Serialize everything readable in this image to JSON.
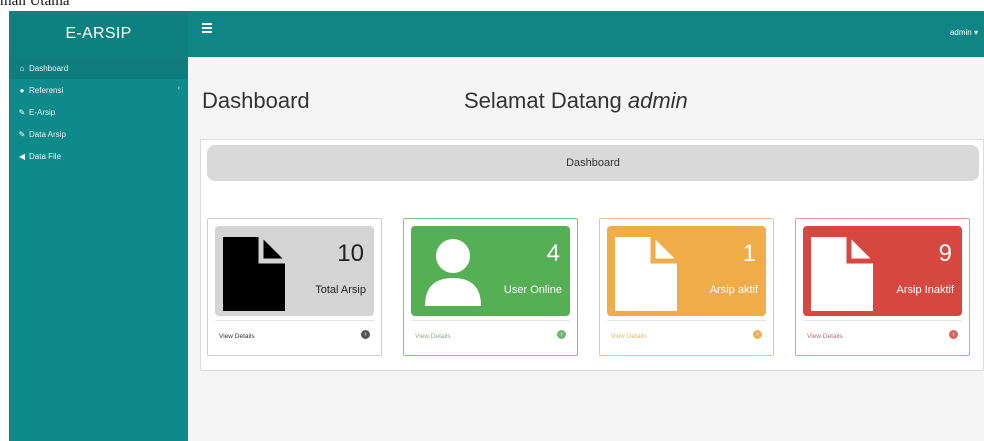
{
  "caption": "man Utama",
  "brand": "E-ARSIP",
  "sidebar": {
    "items": [
      {
        "label": "Dashboard",
        "icon": "home-icon"
      },
      {
        "label": "Referensi",
        "icon": "users-icon"
      },
      {
        "label": "E-Arsip",
        "icon": "pencil-icon"
      },
      {
        "label": "Data Arsip",
        "icon": "pencil-icon"
      },
      {
        "label": "Data File",
        "icon": "file-icon"
      }
    ]
  },
  "topbar": {
    "user": "admin ▾"
  },
  "page": {
    "title": "Dashboard",
    "welcome_prefix": "Selamat Datang ",
    "welcome_user": "admin"
  },
  "panel": {
    "heading": "Dashboard"
  },
  "cards": [
    {
      "count": "10",
      "label": "Total Arsip",
      "details": "View Details",
      "color": "#d4d4d4"
    },
    {
      "count": "4",
      "label": "User Online",
      "details": "View Details",
      "color": "#55b055"
    },
    {
      "count": "1",
      "label": "Arsip aktif",
      "details": "View Details",
      "color": "#f0ac49"
    },
    {
      "count": "9",
      "label": "Arsip Inaktif",
      "details": "View Details",
      "color": "#d5473f"
    }
  ]
}
